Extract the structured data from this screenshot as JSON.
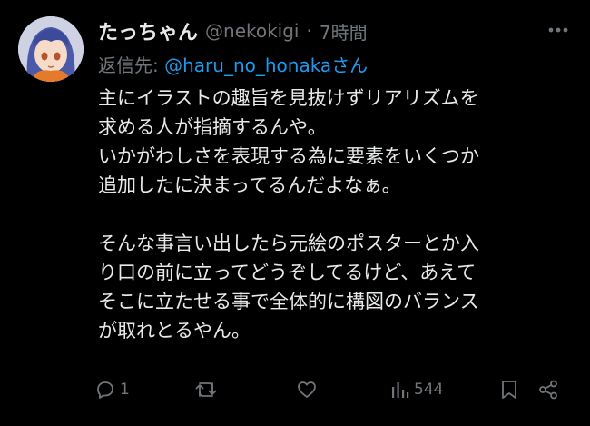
{
  "tweet": {
    "display_name": "たっちゃん",
    "handle": "@nekokigi",
    "separator": "·",
    "time": "7時間",
    "reply_prefix": "返信先: ",
    "reply_to": "@haru_no_honaka",
    "reply_suffix": "さん",
    "text_lines": [
      "主にイラストの趣旨を見抜けずリアリズムを",
      "求める人が指摘するんや。",
      "いかがわしさを表現する為に要素をいくつか",
      "追加したに決まってるんだよなぁ。",
      "",
      "そんな事言い出したら元絵のポスターとか入",
      "り口の前に立ってどうぞしてるけど、あえて",
      "そこに立たせる事で全体的に構図のバランス",
      "が取れとるやん。"
    ],
    "actions": {
      "reply_count": "1",
      "retweet_count": "",
      "like_count": "",
      "views_count": "544"
    }
  },
  "icons": {
    "reply": "reply-icon",
    "retweet": "retweet-icon",
    "like": "heart-icon",
    "views": "views-icon",
    "bookmark": "bookmark-icon",
    "share": "share-icon",
    "more": "more-icon"
  },
  "colors": {
    "background": "#000000",
    "text": "#e7e9ea",
    "secondary": "#71767b",
    "link": "#1d9bf0"
  }
}
